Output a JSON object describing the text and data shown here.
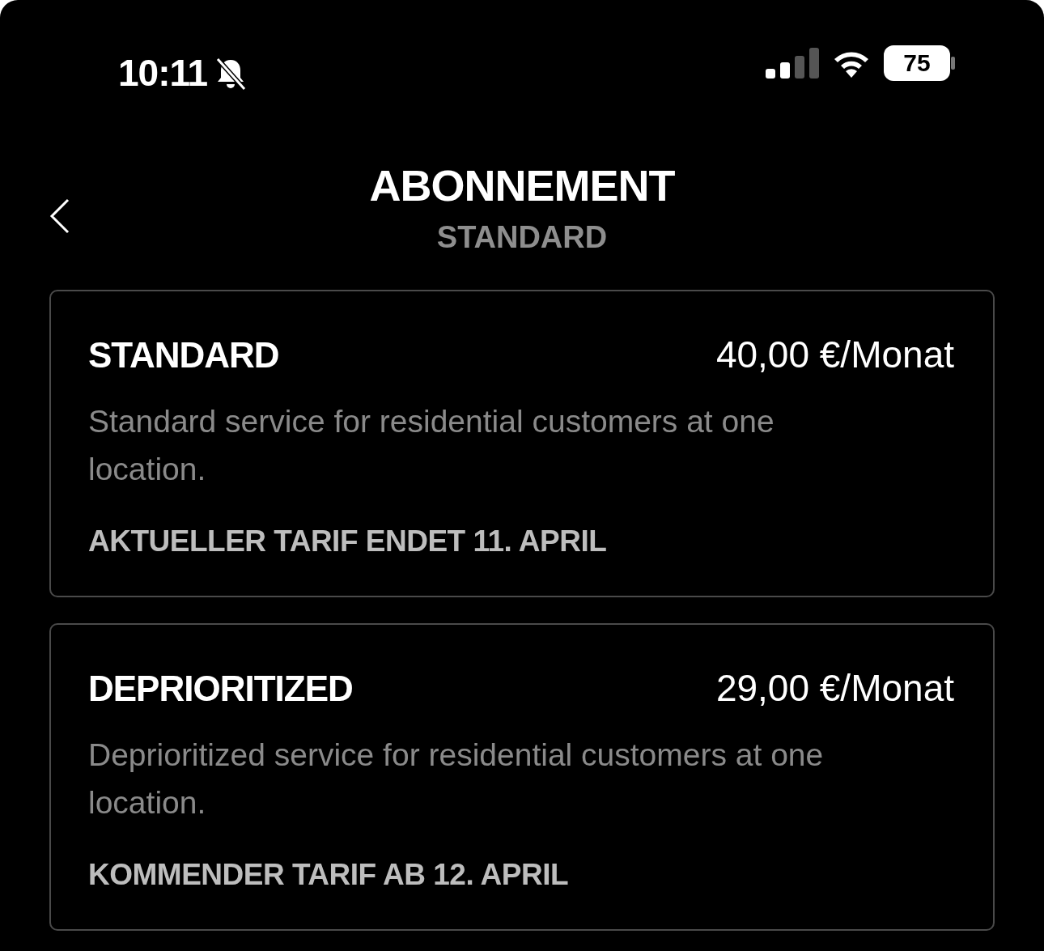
{
  "status_bar": {
    "time": "10:11",
    "silent": true,
    "battery": "75"
  },
  "header": {
    "title": "ABONNEMENT",
    "subtitle": "STANDARD"
  },
  "plans": [
    {
      "name": "STANDARD",
      "price": "40,00 €/Monat",
      "description": "Standard service for residential customers at one location.",
      "note": "AKTUELLER TARIF ENDET 11. APRIL"
    },
    {
      "name": "DEPRIORITIZED",
      "price": "29,00 €/Monat",
      "description": "Deprioritized service for residential customers at one location.",
      "note": "KOMMENDER TARIF AB 12. APRIL"
    }
  ]
}
